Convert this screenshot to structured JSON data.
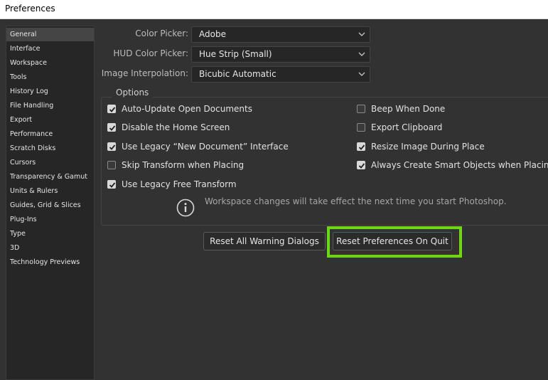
{
  "window": {
    "title": "Preferences"
  },
  "sidebar": {
    "items": [
      {
        "label": "General",
        "selected": true
      },
      {
        "label": "Interface"
      },
      {
        "label": "Workspace"
      },
      {
        "label": "Tools"
      },
      {
        "label": "History Log"
      },
      {
        "label": "File Handling"
      },
      {
        "label": "Export"
      },
      {
        "label": "Performance"
      },
      {
        "label": "Scratch Disks"
      },
      {
        "label": "Cursors"
      },
      {
        "label": "Transparency & Gamut"
      },
      {
        "label": "Units & Rulers"
      },
      {
        "label": "Guides, Grid & Slices"
      },
      {
        "label": "Plug-Ins"
      },
      {
        "label": "Type"
      },
      {
        "label": "3D"
      },
      {
        "label": "Technology Previews"
      }
    ]
  },
  "fields": {
    "color_picker": {
      "label": "Color Picker:",
      "value": "Adobe"
    },
    "hud_color_picker": {
      "label": "HUD Color Picker:",
      "value": "Hue Strip (Small)"
    },
    "image_interpolation": {
      "label": "Image Interpolation:",
      "value": "Bicubic Automatic"
    }
  },
  "options": {
    "title": "Options",
    "left": [
      {
        "label": "Auto-Update Open Documents",
        "checked": true
      },
      {
        "label": "Disable the Home Screen",
        "checked": true
      },
      {
        "label": "Use Legacy “New Document” Interface",
        "checked": true
      },
      {
        "label": "Skip Transform when Placing",
        "checked": false
      },
      {
        "label": "Use Legacy Free Transform",
        "checked": true
      }
    ],
    "right": [
      {
        "label": "Beep When Done",
        "checked": false
      },
      {
        "label": "Export Clipboard",
        "checked": false
      },
      {
        "label": "Resize Image During Place",
        "checked": true
      },
      {
        "label": "Always Create Smart Objects when Placing",
        "checked": true
      }
    ],
    "info_text": "Workspace changes will take effect the next time you start Photoshop."
  },
  "buttons": {
    "reset_warnings": "Reset All Warning Dialogs",
    "reset_prefs": "Reset Preferences On Quit"
  },
  "colors": {
    "highlight": "#6ed617"
  }
}
